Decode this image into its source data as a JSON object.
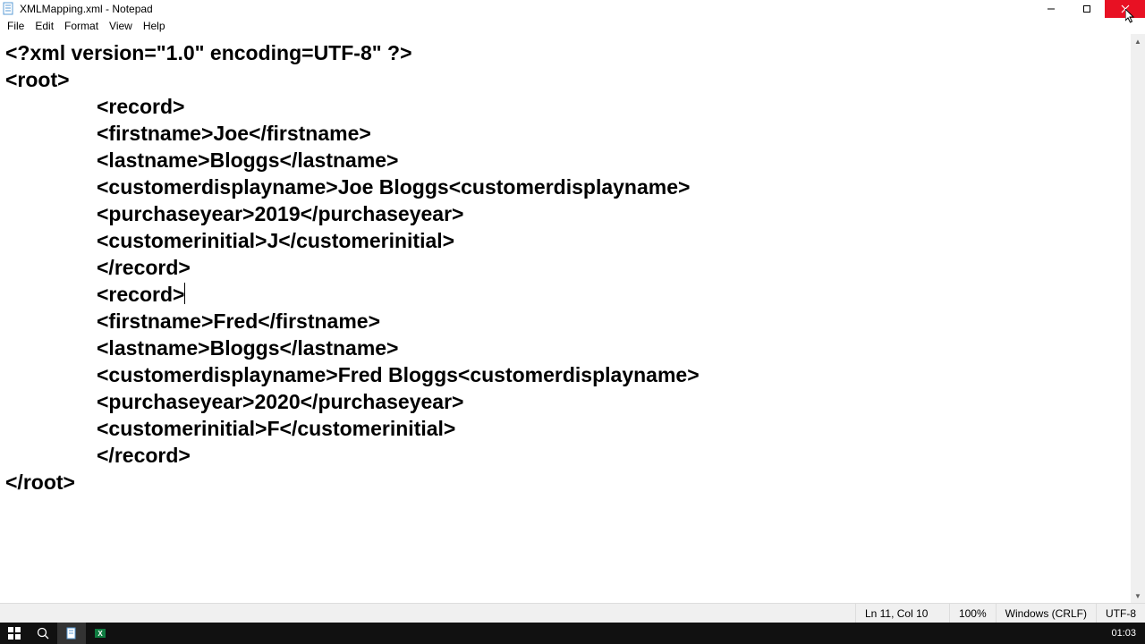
{
  "titlebar": {
    "title": "XMLMapping.xml - Notepad"
  },
  "menu": {
    "file": "File",
    "edit": "Edit",
    "format": "Format",
    "view": "View",
    "help": "Help"
  },
  "content": {
    "l1": "<?xml version=\"1.0\" encoding=UTF-8\" ?>",
    "l2": "<root>",
    "l3": "<record>",
    "l4": "<firstname>Joe</firstname>",
    "l5": "<lastname>Bloggs</lastname>",
    "l6": "<customerdisplayname>Joe Bloggs<customerdisplayname>",
    "l7": "<purchaseyear>2019</purchaseyear>",
    "l8": "<customerinitial>J</customerinitial>",
    "l9": "</record>",
    "l10": "",
    "l11": "<record>",
    "l12": "<firstname>Fred</firstname>",
    "l13": "<lastname>Bloggs</lastname>",
    "l14": "<customerdisplayname>Fred Bloggs<customerdisplayname>",
    "l15": "<purchaseyear>2020</purchaseyear>",
    "l16": "<customerinitial>F</customerinitial>",
    "l17": "</record>",
    "l18": "",
    "l19": "</root>"
  },
  "status": {
    "position": "Ln 11, Col 10",
    "zoom": "100%",
    "eol": "Windows (CRLF)",
    "encoding": "UTF-8"
  },
  "taskbar": {
    "clock": "01:03"
  }
}
